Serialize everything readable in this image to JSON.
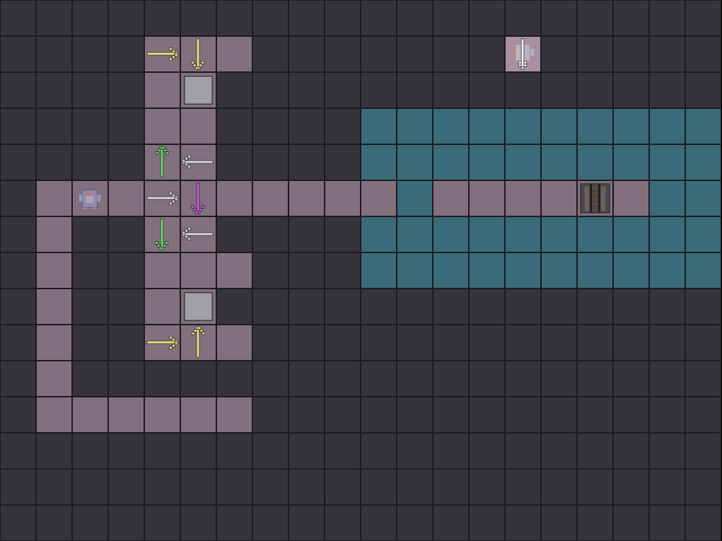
{
  "grid": {
    "cols": 20,
    "rows": 15,
    "map": [
      "wwwwwwwwwwwwwwwwwwww",
      "wwwwfffwwwwwwwfwwwww",
      "wwwwffwwwwwwwwwwwwww",
      "wwwwffwwwwaaaaaaaaaa",
      "wwwwffwwwwaaaaaaaaaa",
      "wffffffffffaffffffaa",
      "wfwwffwwwwaaaaaaaaaa",
      "wfwwfffwwwaaaaaaaaaa",
      "wfwwffwwwwwwwwwwwwww",
      "wfwwfffwwwwwwwwwwwww",
      "wfwwwwwwwwwwwwwwwwww",
      "wffffffwwwwwwwwwwwww",
      "wwwwwwwwwwwwwwwwwwww",
      "wwwwwwwwwwwwwwwwwwww",
      "wwwwwwwwwwwwwwwwwwww"
    ],
    "tile_types": {
      "w": "wall",
      "f": "floor",
      "a": "water"
    }
  },
  "entities": [
    {
      "col": 4,
      "row": 1,
      "kind": "arrow-right-icon",
      "color": "#e6e27a"
    },
    {
      "col": 5,
      "row": 1,
      "kind": "arrow-down-icon",
      "color": "#e6e27a"
    },
    {
      "col": 14,
      "row": 1,
      "kind": "ghost-enemy-icon",
      "color": "#c9c9cf"
    },
    {
      "col": 5,
      "row": 2,
      "kind": "pressure-plate-icon",
      "color": "#a0a0a6"
    },
    {
      "col": 4,
      "row": 4,
      "kind": "arrow-up-icon",
      "color": "#6ad46a"
    },
    {
      "col": 5,
      "row": 4,
      "kind": "arrow-left-icon",
      "color": "#d9d9de"
    },
    {
      "col": 2,
      "row": 5,
      "kind": "robot-player-icon",
      "color": "#8f8aa8"
    },
    {
      "col": 4,
      "row": 5,
      "kind": "arrow-right-icon",
      "color": "#d9d9de"
    },
    {
      "col": 5,
      "row": 5,
      "kind": "arrow-down-icon",
      "color": "#d05ad4"
    },
    {
      "col": 16,
      "row": 5,
      "kind": "ladder-exit-icon",
      "color": "#6b4a3a"
    },
    {
      "col": 4,
      "row": 6,
      "kind": "arrow-down-icon",
      "color": "#6ad46a"
    },
    {
      "col": 5,
      "row": 6,
      "kind": "arrow-left-icon",
      "color": "#d9d9de"
    },
    {
      "col": 5,
      "row": 8,
      "kind": "pressure-plate-icon",
      "color": "#a0a0a6"
    },
    {
      "col": 4,
      "row": 9,
      "kind": "arrow-right-icon",
      "color": "#e6e27a"
    },
    {
      "col": 5,
      "row": 9,
      "kind": "arrow-up-icon",
      "color": "#e6e27a"
    }
  ]
}
